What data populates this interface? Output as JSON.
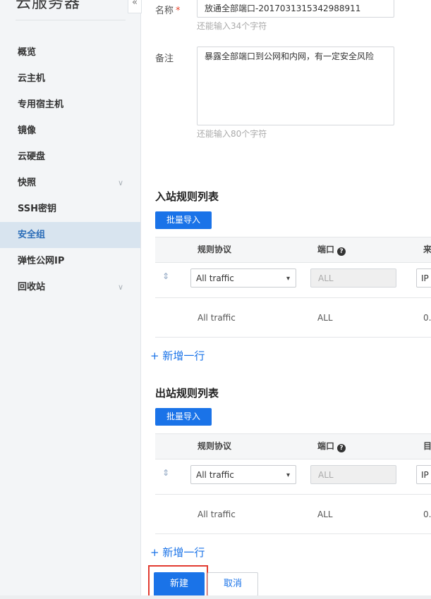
{
  "sidebar": {
    "title": "云服务器",
    "collapse_glyph": "«",
    "items": [
      {
        "label": "概览"
      },
      {
        "label": "云主机"
      },
      {
        "label": "专用宿主机"
      },
      {
        "label": "镜像"
      },
      {
        "label": "云硬盘"
      },
      {
        "label": "快照",
        "chevron": "∨"
      },
      {
        "label": "SSH密钥"
      },
      {
        "label": "安全组",
        "active": true
      },
      {
        "label": "弹性公网IP"
      },
      {
        "label": "回收站",
        "chevron": "∨"
      }
    ]
  },
  "form": {
    "name_label": "名称",
    "required_mark": "*",
    "name_value": "放通全部端口-2017031315342988911",
    "name_hint": "还能输入34个字符",
    "remark_label": "备注",
    "remark_value": "暴露全部端口到公网和内网，有一定安全风险",
    "remark_hint": "还能输入80个字符"
  },
  "inbound": {
    "title": "入站规则列表",
    "import_button": "批量导入",
    "col_protocol": "规则协议",
    "col_port": "端口",
    "col_source": "来",
    "help_glyph": "?",
    "row1": {
      "protocol": "All traffic",
      "port": "ALL",
      "source": "IP"
    },
    "row2": {
      "protocol": "All traffic",
      "port": "ALL",
      "source": "0."
    },
    "add_row": "+ 新增一行"
  },
  "outbound": {
    "title": "出站规则列表",
    "import_button": "批量导入",
    "col_protocol": "规则协议",
    "col_port": "端口",
    "col_dest": "目",
    "help_glyph": "?",
    "row1": {
      "protocol": "All traffic",
      "port": "ALL",
      "dest": "IP"
    },
    "row2": {
      "protocol": "All traffic",
      "port": "ALL",
      "dest": "0."
    },
    "add_row": "+ 新增一行"
  },
  "actions": {
    "create": "新建",
    "cancel": "取消"
  },
  "icons": {
    "drag": "⇕",
    "caret": "▾"
  },
  "colors": {
    "primary": "#1a73e8",
    "active_bg": "#d8e4ef",
    "highlight": "#e23b30"
  }
}
